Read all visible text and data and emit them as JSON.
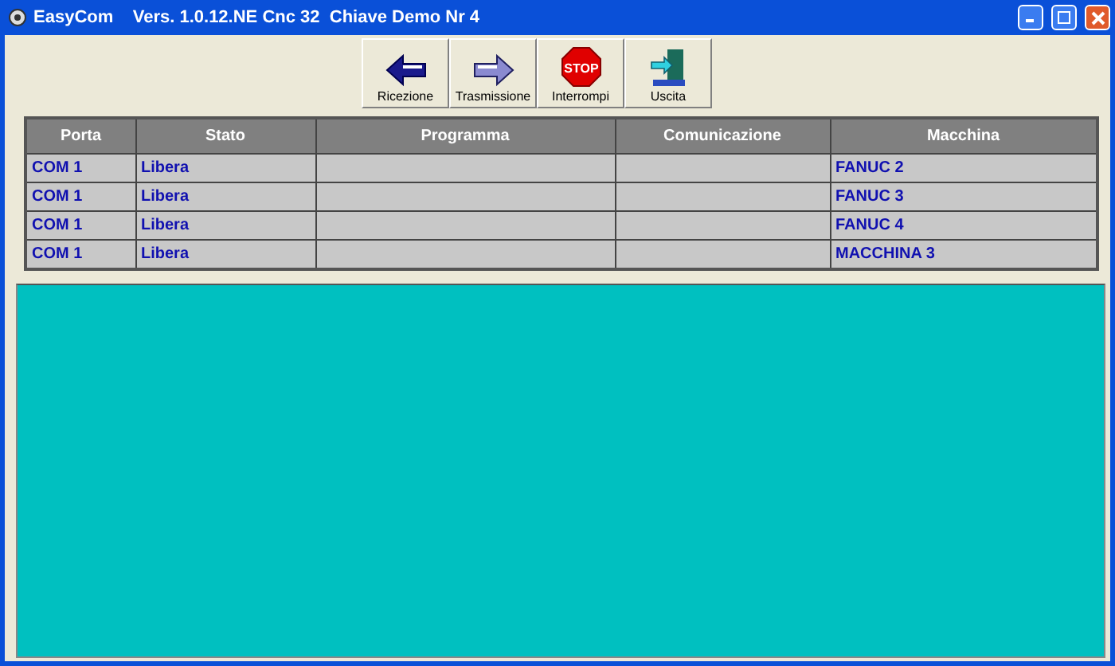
{
  "window": {
    "title": "EasyCom    Vers. 1.0.12.NE Cnc 32  Chiave Demo Nr 4"
  },
  "toolbar": [
    {
      "label": "Ricezione",
      "kind": "receive"
    },
    {
      "label": "Trasmissione",
      "kind": "send"
    },
    {
      "label": "Interrompi",
      "kind": "stop",
      "icon_text": "STOP"
    },
    {
      "label": "Uscita",
      "kind": "exit"
    }
  ],
  "table": {
    "columns": [
      "Porta",
      "Stato",
      "Programma",
      "Comunicazione",
      "Macchina"
    ],
    "rows": [
      [
        "COM 1",
        "Libera",
        "",
        "",
        "FANUC 2"
      ],
      [
        "COM 1",
        "Libera",
        "",
        "",
        "FANUC 3"
      ],
      [
        "COM 1",
        "Libera",
        "",
        "",
        "FANUC 4"
      ],
      [
        "COM 1",
        "Libera",
        "",
        "",
        "MACCHINA 3"
      ]
    ]
  }
}
